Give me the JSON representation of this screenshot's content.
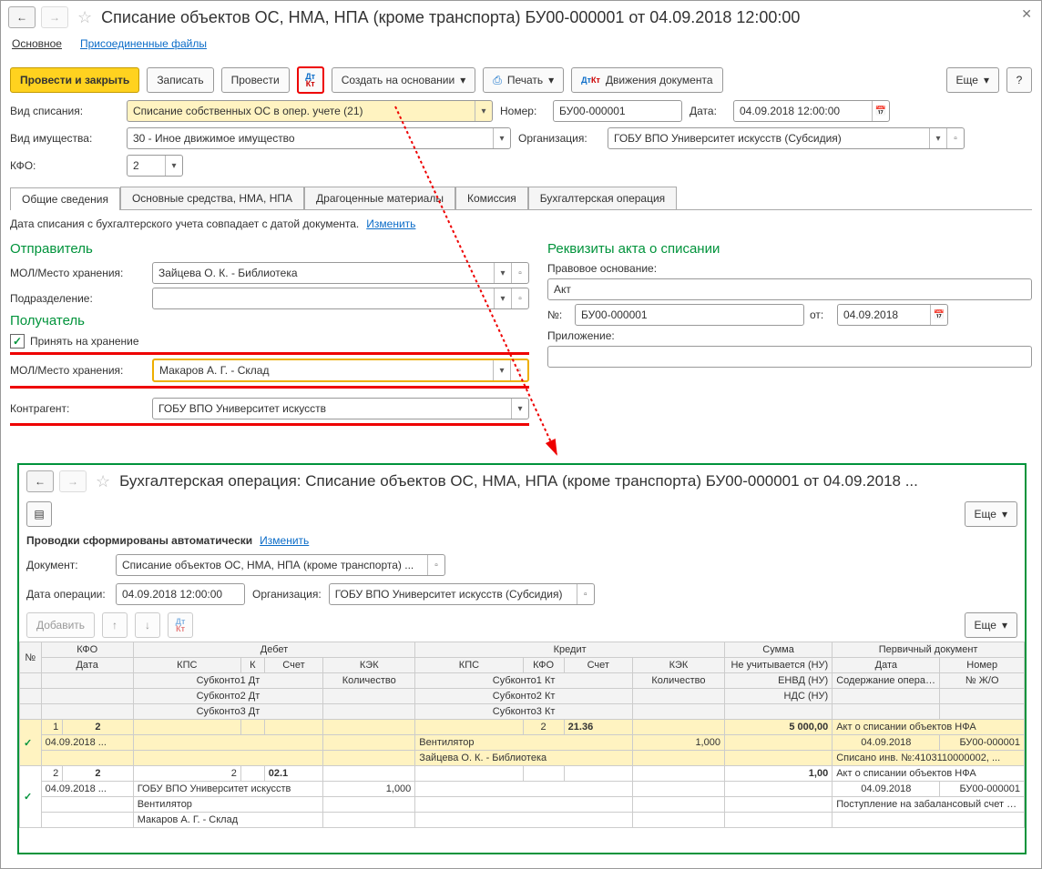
{
  "header": {
    "title": "Списание объектов ОС, НМА, НПА (кроме транспорта) БУ00-000001 от 04.09.2018 12:00:00",
    "nav_main": "Основное",
    "nav_files": "Присоединенные файлы"
  },
  "toolbar": {
    "post_close": "Провести и закрыть",
    "save": "Записать",
    "post": "Провести",
    "create_on_basis": "Создать на основании",
    "print": "Печать",
    "movements": "Движения документа",
    "more": "Еще",
    "help": "?"
  },
  "form": {
    "writeoff_type_lbl": "Вид списания:",
    "writeoff_type_val": "Списание собственных ОС в опер. учете (21)",
    "number_lbl": "Номер:",
    "number_val": "БУ00-000001",
    "date_lbl": "Дата:",
    "date_val": "04.09.2018 12:00:00",
    "asset_kind_lbl": "Вид имущества:",
    "asset_kind_val": "30 - Иное движимое имущество",
    "org_lbl": "Организация:",
    "org_val": "ГОБУ ВПО Университет искусств (Субсидия)",
    "kfo_lbl": "КФО:",
    "kfo_val": "2"
  },
  "tabs": {
    "t1": "Общие сведения",
    "t2": "Основные средства, НМА, НПА",
    "t3": "Драгоценные материалы",
    "t4": "Комиссия",
    "t5": "Бухгалтерская операция"
  },
  "general": {
    "note": "Дата списания с бухгалтерского учета совпадает с датой документа.",
    "change": "Изменить",
    "sender_h": "Отправитель",
    "mol_lbl": "МОЛ/Место хранения:",
    "mol_sender": "Зайцева О. К. - Библиотека",
    "dept_lbl": "Подразделение:",
    "dept_val": "",
    "receiver_h": "Получатель",
    "take_storage": "Принять на хранение",
    "mol_receiver": "Макаров А. Г. - Склад",
    "contragent_lbl": "Контрагент:",
    "contragent_val": "ГОБУ ВПО Университет искусств",
    "act_h": "Реквизиты акта о списании",
    "legal_basis_lbl": "Правовое основание:",
    "legal_basis_val": "Акт",
    "act_num_lbl": "№:",
    "act_num_val": "БУ00-000001",
    "act_date_lbl": "от:",
    "act_date_val": "04.09.2018",
    "attachment_lbl": "Приложение:",
    "attachment_val": ""
  },
  "inner": {
    "title": "Бухгалтерская операция: Списание объектов ОС, НМА, НПА (кроме транспорта) БУ00-000001 от 04.09.2018 ...",
    "more": "Еще",
    "auto_note": "Проводки сформированы автоматически",
    "change": "Изменить",
    "doc_lbl": "Документ:",
    "doc_val": "Списание объектов ОС, НМА, НПА (кроме транспорта) ...",
    "opdate_lbl": "Дата операции:",
    "opdate_val": "04.09.2018 12:00:00",
    "org_lbl": "Организация:",
    "org_val": "ГОБУ ВПО Университет искусств (Субсидия)",
    "add": "Добавить"
  },
  "grid": {
    "h_num": "№",
    "h_kfo": "КФО",
    "h_date": "Дата",
    "h_debit": "Дебет",
    "h_credit": "Кредит",
    "h_sum": "Сумма",
    "h_primary": "Первичный документ",
    "h_kps": "КПС",
    "h_k": "К",
    "h_acct": "Счет",
    "h_kek": "КЭК",
    "h_kfo2": "КФО",
    "h_acct2": "Счет",
    "h_kek2": "КЭК",
    "h_nu": "Не учитывается (НУ)",
    "h_pdate": "Дата",
    "h_pnum": "Номер",
    "h_sub1dt": "Субконто1 Дт",
    "h_sub2dt": "Субконто2 Дт",
    "h_sub3dt": "Субконто3 Дт",
    "h_qty": "Количество",
    "h_sub1kt": "Субконто1 Кт",
    "h_sub2kt": "Субконто2 Кт",
    "h_sub3kt": "Субконто3 Кт",
    "h_qty2": "Количество",
    "h_envd": "ЕНВД (НУ)",
    "h_nds": "НДС (НУ)",
    "h_content": "Содержание операции",
    "h_jno": "№ Ж/О",
    "r1_num": "1",
    "r1_kfo": "2",
    "r1_date": "04.09.2018 ...",
    "r1_kfo2": "2",
    "r1_acct2": "21.36",
    "r1_sum": "5 000,00",
    "r1_prim": "Акт о списании объектов НФА",
    "r1_pdate": "04.09.2018",
    "r1_pnum": "БУ00-000001",
    "r1_sub1kt": "Вентилятор",
    "r1_qty2": "1,000",
    "r1_sub2kt": "Зайцева О. К. - Библиотека",
    "r1_content": "Списано инв. №:4103110000002, ...",
    "r2_num": "2",
    "r2_kfo": "2",
    "r2_date": "04.09.2018 ...",
    "r2_kps": "2",
    "r2_acct": "02.1",
    "r2_qty": "1,000",
    "r2_sum": "1,00",
    "r2_sub1dt": "ГОБУ ВПО Университет искусств",
    "r2_sub2dt": "Вентилятор",
    "r2_sub3dt": "Макаров А. Г. - Склад",
    "r2_prim": "Акт о списании объектов НФА",
    "r2_pdate": "04.09.2018",
    "r2_pnum": "БУ00-000001",
    "r2_content": "Поступление на забалансовый счет инв."
  }
}
